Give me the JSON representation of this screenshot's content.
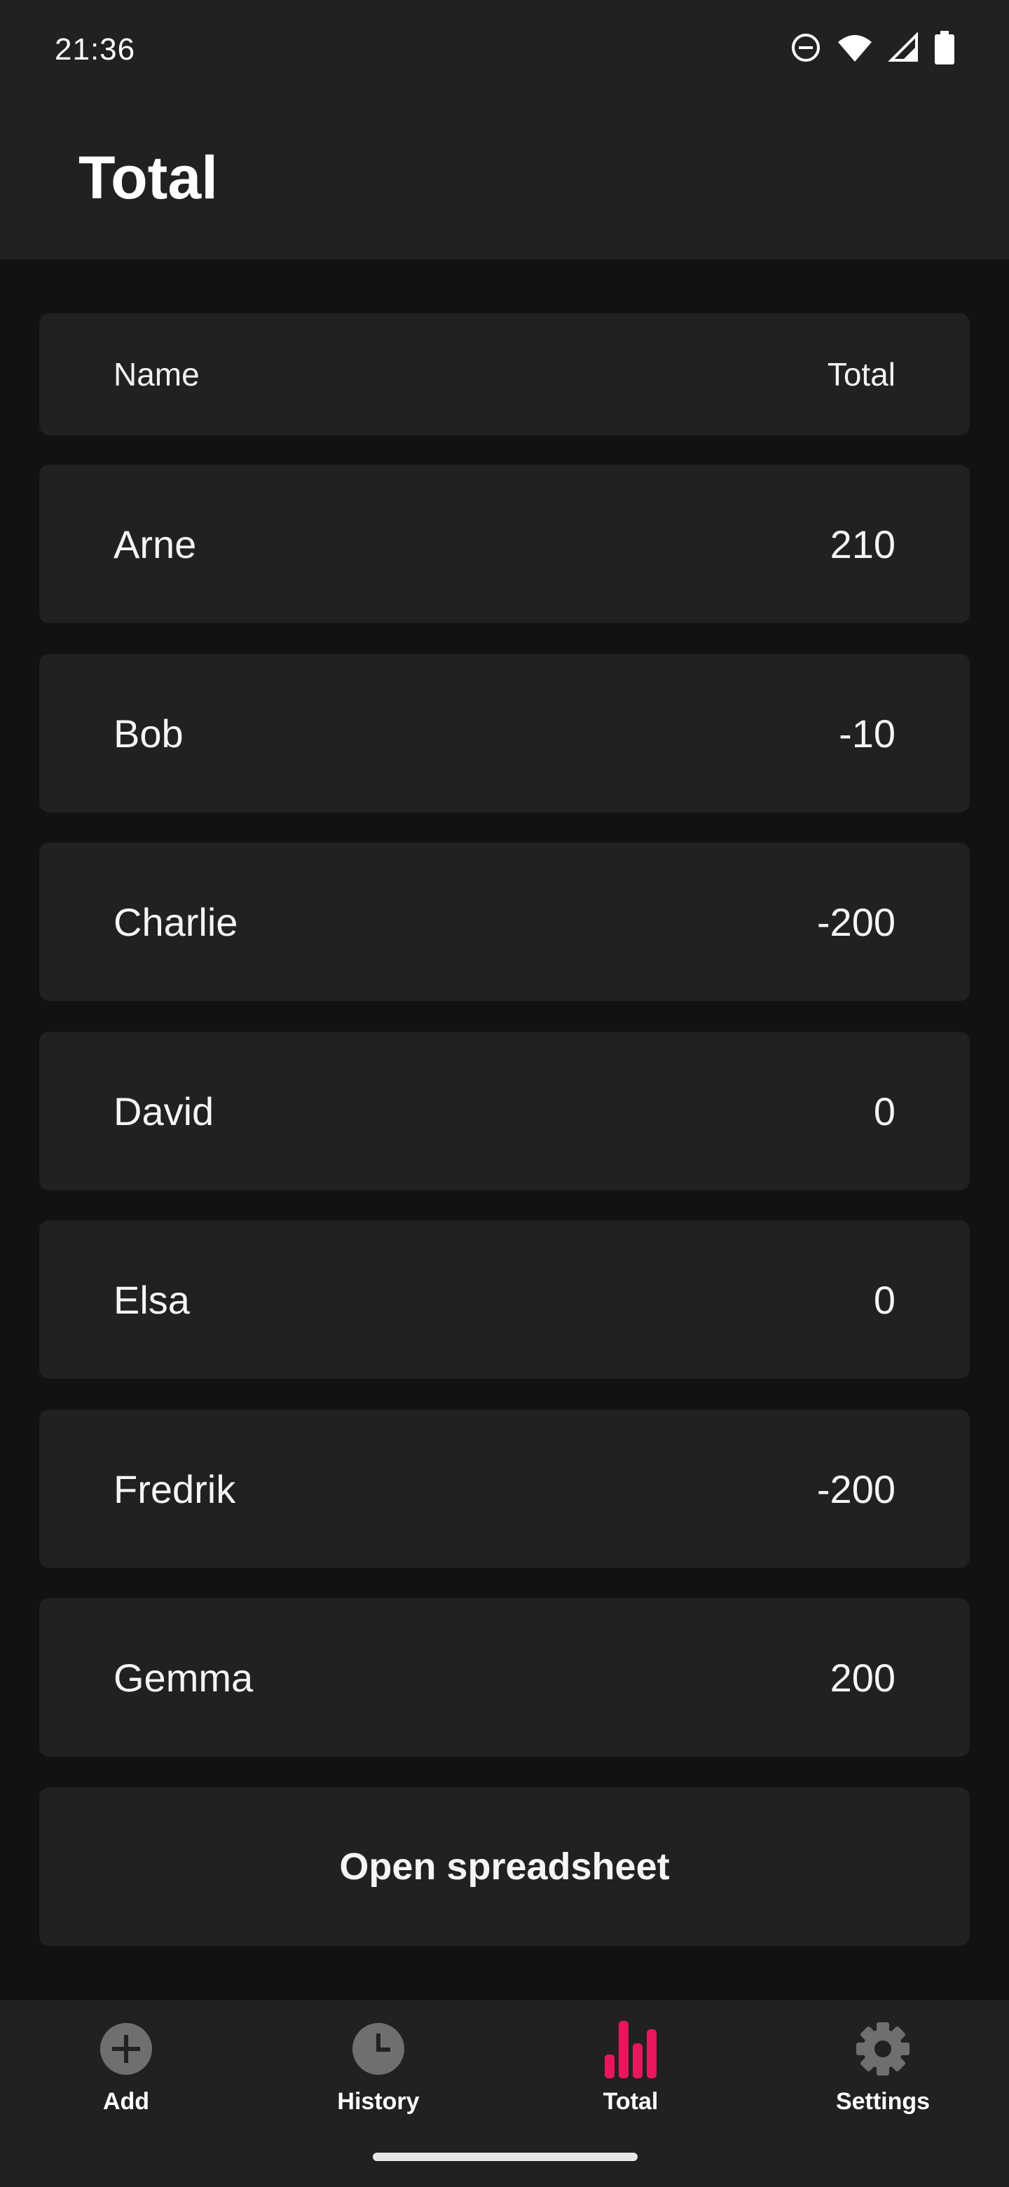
{
  "status_bar": {
    "time": "21:36",
    "icons": [
      "do-not-disturb-icon",
      "wifi-icon",
      "cellular-signal-icon",
      "battery-icon"
    ]
  },
  "app_bar": {
    "title": "Total"
  },
  "table": {
    "headers": {
      "name": "Name",
      "total": "Total"
    },
    "rows": [
      {
        "name": "Arne",
        "total": "210"
      },
      {
        "name": "Bob",
        "total": "-10"
      },
      {
        "name": "Charlie",
        "total": "-200"
      },
      {
        "name": "David",
        "total": "0"
      },
      {
        "name": "Elsa",
        "total": "0"
      },
      {
        "name": "Fredrik",
        "total": "-200"
      },
      {
        "name": "Gemma",
        "total": "200"
      }
    ]
  },
  "actions": {
    "open_spreadsheet": "Open spreadsheet"
  },
  "bottom_nav": {
    "items": [
      {
        "label": "Add",
        "icon": "add-circle-icon",
        "active": false
      },
      {
        "label": "History",
        "icon": "clock-icon",
        "active": false
      },
      {
        "label": "Total",
        "icon": "bar-chart-icon",
        "active": true
      },
      {
        "label": "Settings",
        "icon": "gear-icon",
        "active": false
      }
    ]
  },
  "colors": {
    "accent": "#e8175d",
    "surface": "#212121",
    "background": "#121212",
    "inactive_icon": "#6f6f6f"
  }
}
